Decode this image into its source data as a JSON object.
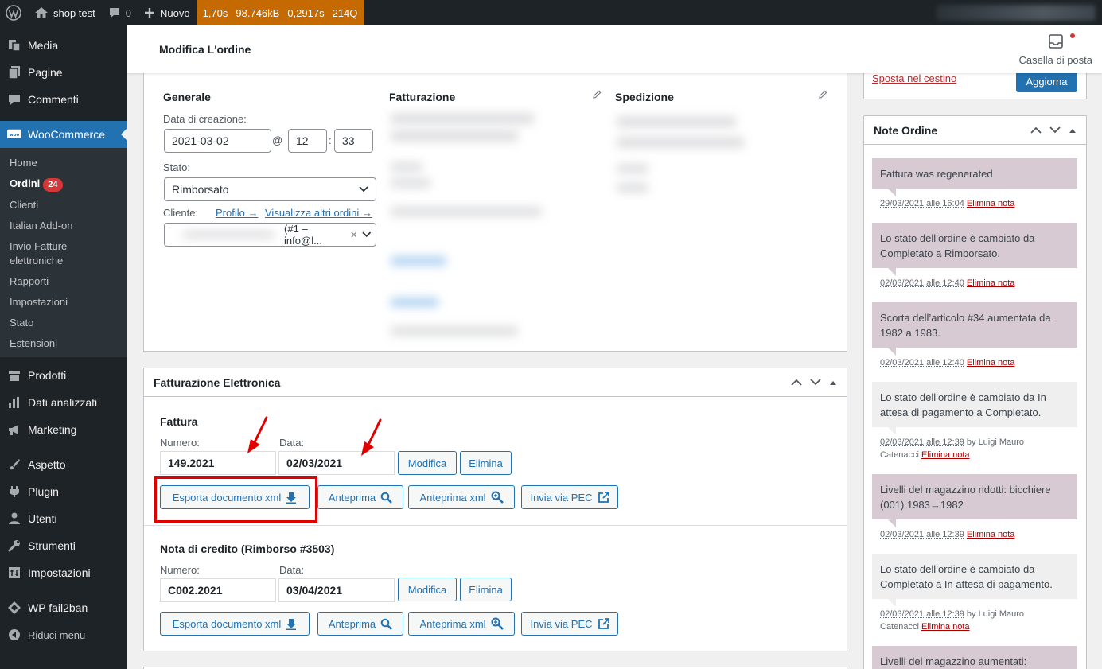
{
  "admin_bar": {
    "site_name": "shop test",
    "comments_count": "0",
    "new_label": "Nuovo",
    "qm": [
      "1,70s",
      "98.746kB",
      "0,2917s",
      "214Q"
    ]
  },
  "sidebar": {
    "top_items": [
      "Media",
      "Pagine",
      "Commenti"
    ],
    "woo_label": "WooCommerce",
    "sub_items": [
      "Home",
      "Ordini",
      "Clienti",
      "Italian Add-on",
      "Invio Fatture elettroniche",
      "Rapporti",
      "Impostazioni",
      "Stato",
      "Estensioni"
    ],
    "orders_badge": "24",
    "bottom_items": [
      "Prodotti",
      "Dati analizzati",
      "Marketing",
      "Aspetto",
      "Plugin",
      "Utenti",
      "Strumenti",
      "Impostazioni",
      "WP fail2ban"
    ],
    "collapse_label": "Riduci menu"
  },
  "header": {
    "title": "Modifica L'ordine",
    "inbox_label": "Casella di posta"
  },
  "order": {
    "general_title": "Generale",
    "created_label": "Data di creazione:",
    "date": "2021-03-02",
    "at": "@",
    "hour": "12",
    "sep": ":",
    "minute": "33",
    "status_label": "Stato:",
    "status": "Rimborsato",
    "customer_label": "Cliente:",
    "profile_link": "Profilo →",
    "other_orders_link": "Visualizza altri ordini →",
    "customer_value": "(#1 – info@l...",
    "billing_title": "Fatturazione",
    "shipping_title": "Spedizione"
  },
  "einvoice": {
    "title": "Fatturazione Elettronica",
    "invoice": {
      "title": "Fattura",
      "number_label": "Numero:",
      "number": "149.2021",
      "date_label": "Data:",
      "date": "02/03/2021"
    },
    "credit": {
      "title": "Nota di credito (Rimborso #3503)",
      "number_label": "Numero:",
      "number": "C002.2021",
      "date_label": "Data:",
      "date": "03/04/2021"
    },
    "buttons": {
      "edit": "Modifica",
      "delete": "Elimina",
      "export": "Esporta documento xml",
      "preview": "Anteprima",
      "preview_xml": "Anteprima xml",
      "send_pec": "Invia via PEC"
    }
  },
  "actions": {
    "trash_link": "Sposta nel cestino",
    "update_button": "Aggiorna"
  },
  "notes": {
    "title": "Note Ordine",
    "delete_label": "Elimina nota",
    "by_label": "by Luigi Mauro",
    "by_label2": "Catenacci",
    "items": [
      {
        "text": "Fattura was regenerated",
        "date": "29/03/2021 alle 16:04"
      },
      {
        "text": "Lo stato dell’ordine è cambiato da Completato a Rimborsato.",
        "date": "02/03/2021 alle 12:40"
      },
      {
        "text": "Scorta dell’articolo #34 aumentata da 1982 a 1983.",
        "date": "02/03/2021 alle 12:40"
      },
      {
        "text": "Lo stato dell’ordine è cambiato da In attesa di pagamento a Completato.",
        "date": "02/03/2021 alle 12:39"
      },
      {
        "text": "Livelli del magazzino ridotti: bicchiere (001) 1983→1982",
        "date": "02/03/2021 alle 12:39"
      },
      {
        "text": "Lo stato dell’ordine è cambiato da Completato a In attesa di pagamento.",
        "date": "02/03/2021 alle 12:39"
      },
      {
        "text": "Livelli del magazzino aumentati:",
        "date": ""
      }
    ]
  },
  "colors": {
    "accent": "#2271b1",
    "sidebar_bg": "#1d2327",
    "qm_bg": "#c46a00",
    "highlight": "#e00000",
    "system_note": "#d7cad2"
  }
}
